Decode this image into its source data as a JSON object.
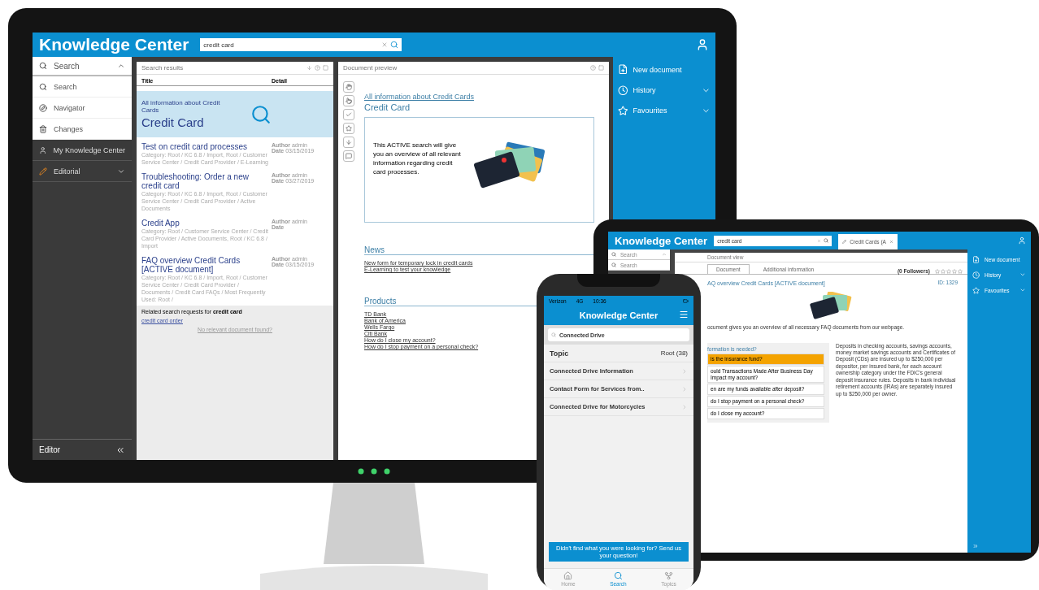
{
  "monitor": {
    "header": {
      "title": "Knowledge Center",
      "search": {
        "value": "credit card"
      }
    },
    "sidebar": {
      "sections": [
        {
          "label": "Search",
          "expanded": true,
          "children": [
            {
              "label": "Search"
            },
            {
              "label": "Navigator"
            },
            {
              "label": "Changes"
            }
          ]
        },
        {
          "label": "My Knowledge Center"
        },
        {
          "label": "Editorial",
          "expanded": false
        }
      ],
      "footer": {
        "label": "Editor"
      }
    },
    "results": {
      "title": "Search results",
      "columns": [
        "Title",
        "Detail"
      ],
      "rows": [
        {
          "kind": "featured",
          "subtitle": "All information about Credit Cards",
          "title": "Credit Card",
          "selected": true
        },
        {
          "kind": "result",
          "title": "Test on credit card processes",
          "category": "Category: Root / KC 6.8 / Import, Root / Customer Service Center / Credit Card Provider / E-Learning",
          "author": "**Author** admin",
          "date": "**Date** 03/15/2019",
          "selected": false
        },
        {
          "kind": "result",
          "title": "Troubleshooting: Order a new credit card",
          "category": "Category: Root / KC 6.8 / Import, Root / Customer Service Center / Credit Card Provider / Active Documents",
          "author": "**Author** admin",
          "date": "**Date** 03/27/2019",
          "selected": false
        },
        {
          "kind": "result",
          "title": "Credit App",
          "category": "Category: Root / Customer Service Center / Credit Card Provider / Active Documents, Root / KC 6.8 / Import",
          "author": "**Author** admin",
          "date": "**Date**",
          "selected": false
        },
        {
          "kind": "result",
          "title": "FAQ overview Credit Cards [ACTIVE document]",
          "category": "Category: Root / KC 6.8 / Import, Root / Customer Service Center / Credit Card Provider / Documents / Credit Card FAQs / Most Frequently Used: Root /",
          "author": "**Author** admin",
          "date": "**Date** 03/15/2019",
          "selected": false
        }
      ],
      "related": {
        "text": "Related search requests for **credit card**",
        "links": [
          "credit card order"
        ]
      },
      "no_result_link": "No relevant document found?"
    },
    "preview": {
      "title": "Document preview",
      "link": "All information about Credit Cards",
      "heading": "Credit Card",
      "card_text": "This ACTIVE search will give you an overview of all relevant information regarding credit card processes.",
      "sections": [
        {
          "title": "News",
          "links": [
            "New form for temporary lock in credit cards",
            "E-Learning to test your knowledge"
          ]
        },
        {
          "title": "Products",
          "links": [
            "TD Bank",
            "Bank of America",
            "Wells Fargo",
            "Citi Bank",
            "How do I close my account?",
            "How do I stop payment on a personal check?"
          ]
        }
      ]
    },
    "actions": [
      {
        "label": "New document"
      },
      {
        "label": "History",
        "expanded": false
      },
      {
        "label": "Favourites",
        "expanded": false
      }
    ]
  },
  "tablet": {
    "header": {
      "title": "Knowledge Center",
      "search": {
        "value": "credit card"
      },
      "open_tab": {
        "label": "Credit Cards (A"
      }
    },
    "sidebar": [
      {
        "label": "Search",
        "expanded": true
      },
      {
        "label": "Search"
      }
    ],
    "document": {
      "title": "Document view",
      "tabs": [
        {
          "label": "Document",
          "selected": true
        },
        {
          "label": "Additional information",
          "selected": false
        }
      ],
      "followers": "(0 Followers)",
      "stars": 0,
      "heading": "AQ overview Credit Cards [ACTIVE document]",
      "id": "ID: 1329",
      "intro": "ocument gives you an overview of all necessary FAQ documents from our webpage.",
      "faq": {
        "title": "formation is needed?",
        "items": [
          {
            "label": "is the insurance fund?",
            "selected": true
          },
          {
            "label": "ould Transactions Made After Business Day Impact my account?",
            "selected": false
          },
          {
            "label": "en are my funds available after deposit?",
            "selected": false
          },
          {
            "label": "do I stop payment on a personal check?",
            "selected": false
          },
          {
            "label": "do I close my account?",
            "selected": false
          }
        ]
      },
      "paragraph": "Deposits in checking accounts, savings accounts, money market savings accounts and Certificates of Deposit (CDs) are insured up to $250,000 per depositor, per insured bank, for each account ownership category under the FDIC's general deposit insurance rules. Deposits in bank individual retirement accounts (IRAs) are separately insured up to $250,000 per owner."
    },
    "actions": [
      {
        "label": "New document"
      },
      {
        "label": "History",
        "expanded": false
      },
      {
        "label": "Favourites",
        "expanded": false
      }
    ]
  },
  "phone": {
    "status": {
      "carrier": "Verizon",
      "network": "4G",
      "time": "10:36"
    },
    "title": "Knowledge Center",
    "search": {
      "value": "Connected Drive"
    },
    "filter": {
      "label": "Topic",
      "value": "Root (38)"
    },
    "items": [
      "Connected Drive Information",
      "Contact Form for Services from..",
      "Connected Drive for Motorcycles"
    ],
    "cta": "Didn't find what you were looking for? Send us your question!",
    "tabs": [
      {
        "label": "Home",
        "selected": false
      },
      {
        "label": "Search",
        "selected": true
      },
      {
        "label": "Topics",
        "selected": false
      }
    ]
  }
}
